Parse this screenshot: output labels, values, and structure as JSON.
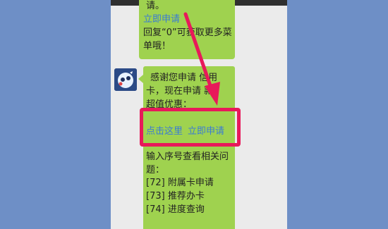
{
  "chat": {
    "top_bubble": {
      "line1": "请。",
      "apply_link": "立即申请",
      "line3": "回复“0”可获取更多菜",
      "line4": "单哦！"
    },
    "main_bubble": {
      "line1": "感谢您申请   信用",
      "line2": "卡，现在申请   款",
      "line3": "超值优惠：",
      "link_click_here": "点击这里",
      "link_apply_now": "立即申请",
      "prompt_line1": "输入序号查看相关问",
      "prompt_line2": "题：",
      "option1": "[72] 附属卡申请",
      "option2": "[73] 推荐办卡",
      "option3": "[74] 进度查询"
    }
  },
  "annotations": {
    "highlight_color": "#e8195a",
    "arrow_color": "#e8195a"
  },
  "colors": {
    "background": "#6e8fc6",
    "bubble": "#9fd24f",
    "link": "#3a7bd5"
  }
}
